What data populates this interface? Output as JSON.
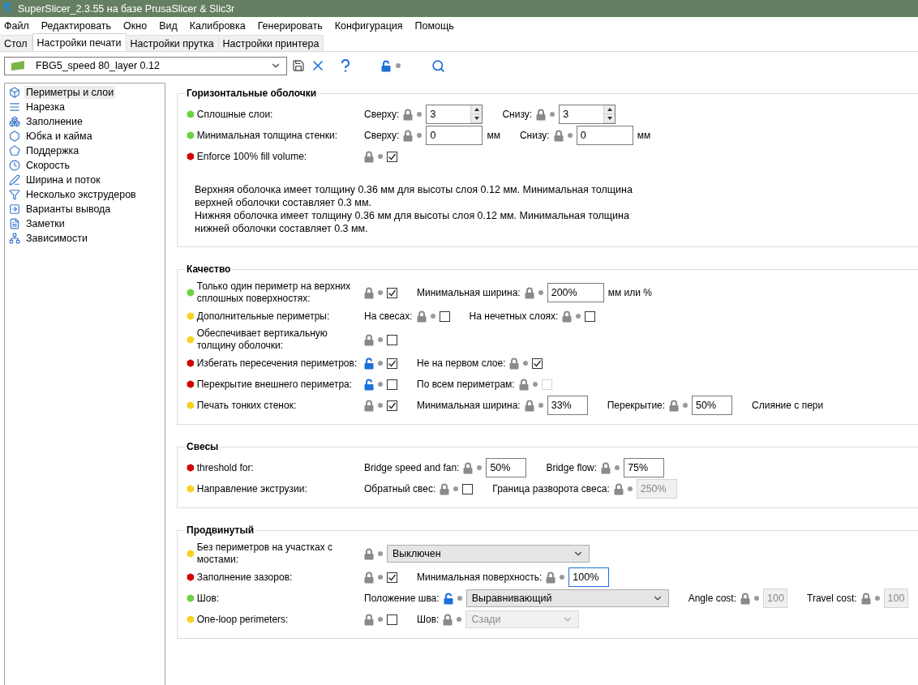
{
  "window": {
    "title": "SuperSlicer_2.3.55 на базе PrusaSlicer & Slic3r"
  },
  "menu": [
    "Файл",
    "Редактировать",
    "Окно",
    "Вид",
    "Калибровка",
    "Генерировать",
    "Конфигурация",
    "Помощь"
  ],
  "tabs": [
    {
      "label": "Стол",
      "selected": false
    },
    {
      "label": "Настройки печати",
      "selected": true
    },
    {
      "label": "Настройки прутка",
      "selected": false
    },
    {
      "label": "Настройки принтера",
      "selected": false
    }
  ],
  "preset": {
    "value": "FBG5_speed 80_layer 0.12",
    "color": "#7ab648"
  },
  "toolbar": {
    "locked": false
  },
  "sidebar": {
    "items": [
      {
        "label": "Периметры и слои",
        "selected": true
      },
      {
        "label": "Нарезка",
        "selected": false
      },
      {
        "label": "Заполнение",
        "selected": false
      },
      {
        "label": "Юбка и кайма",
        "selected": false
      },
      {
        "label": "Поддержка",
        "selected": false
      },
      {
        "label": "Скорость",
        "selected": false
      },
      {
        "label": "Ширина и поток",
        "selected": false
      },
      {
        "label": "Несколько экструдеров",
        "selected": false
      },
      {
        "label": "Варианты вывода",
        "selected": false
      },
      {
        "label": "Заметки",
        "selected": false
      },
      {
        "label": "Зависимости",
        "selected": false
      }
    ]
  },
  "sections": [
    {
      "title": "Горизонтальные оболочки",
      "rows": [
        {
          "label": "Сплошные слои:",
          "color": "#6ad33f",
          "fields": [
            {
              "label": "Сверху:",
              "locked": true,
              "kind": "spin",
              "value": "3"
            },
            {
              "label": "Снизу:",
              "locked": true,
              "kind": "spin",
              "value": "3"
            }
          ]
        },
        {
          "label": "Минимальная толщина стенки:",
          "color": "#6ad33f",
          "fields": [
            {
              "label": "Сверху:",
              "locked": true,
              "kind": "text",
              "value": "0",
              "unit": "мм"
            },
            {
              "label": "Снизу:",
              "locked": true,
              "kind": "text",
              "value": "0",
              "unit": "мм"
            }
          ]
        },
        {
          "label": "Enforce 100% fill volume:",
          "color": "#d40000",
          "fields": [
            {
              "locked": true,
              "kind": "check",
              "checked": true
            }
          ]
        }
      ],
      "notes": [
        "Верхняя оболочка имеет толщину 0.36 мм для высоты слоя 0.12 мм. Минимальная толщина верхней оболочки составляет 0.3 мм.",
        "Нижняя оболочка имеет толщину 0.36 мм для высоты слоя 0.12 мм. Минимальная толщина нижней оболочки составляет 0.3 мм."
      ]
    },
    {
      "title": "Качество",
      "rows": [
        {
          "label": "Только один периметр на верхних сплошных поверхностях:",
          "color": "#6ad33f",
          "fields": [
            {
              "locked": true,
              "kind": "check",
              "checked": true
            },
            {
              "label": "Минимальная ширина:",
              "locked": true,
              "kind": "text",
              "value": "200%",
              "unit": "мм или %"
            }
          ]
        },
        {
          "label": "Дополнительные периметры:",
          "color": "#f7d21e",
          "fields": [
            {
              "label": "На свесах:",
              "locked": true,
              "kind": "check",
              "checked": false
            },
            {
              "label": "На нечетных слоях:",
              "locked": true,
              "kind": "check",
              "checked": false
            }
          ]
        },
        {
          "label": "Обеспечивает вертикальную толщину оболочки:",
          "color": "#f7d21e",
          "fields": [
            {
              "locked": true,
              "kind": "check",
              "checked": false
            }
          ]
        },
        {
          "label": "Избегать пересечения периметров:",
          "color": "#d40000",
          "fields": [
            {
              "locked": false,
              "kind": "check",
              "checked": true
            },
            {
              "label": "Не на первом слое:",
              "locked": true,
              "kind": "check",
              "checked": true
            }
          ]
        },
        {
          "label": "Перекрытие внешнего периметра:",
          "color": "#d40000",
          "fields": [
            {
              "locked": false,
              "kind": "check",
              "checked": false
            },
            {
              "label": "По всем периметрам:",
              "locked": true,
              "kind": "check",
              "checked": false,
              "disabled": true
            }
          ]
        },
        {
          "label": "Печать тонких стенок:",
          "color": "#f7d21e",
          "fields": [
            {
              "locked": true,
              "kind": "check",
              "checked": true
            },
            {
              "label": "Минимальная ширина:",
              "locked": true,
              "kind": "text",
              "value": "33%"
            },
            {
              "label": "Перекрытие:",
              "locked": true,
              "kind": "text",
              "value": "50%"
            },
            {
              "label": "Слияние с пери",
              "kind": "label"
            }
          ]
        }
      ]
    },
    {
      "title": "Свесы",
      "rows": [
        {
          "label": "threshold for:",
          "color": "#d40000",
          "fields": [
            {
              "label": "Bridge speed and fan:",
              "locked": true,
              "kind": "text",
              "value": "50%"
            },
            {
              "label": "Bridge flow:",
              "locked": true,
              "kind": "text",
              "value": "75%"
            }
          ]
        },
        {
          "label": "Направление экструзии:",
          "color": "#f7d21e",
          "fields": [
            {
              "label": "Обратный свес:",
              "locked": true,
              "kind": "check",
              "checked": false
            },
            {
              "label": "Граница разворота свеса:",
              "locked": true,
              "kind": "text",
              "value": "250%",
              "disabled": true
            }
          ]
        }
      ]
    },
    {
      "title": "Продвинутый",
      "rows": [
        {
          "label": "Без периметров на участках с мостами:",
          "color": "#f7d21e",
          "fields": [
            {
              "locked": true,
              "kind": "select",
              "value": "Выключен"
            }
          ]
        },
        {
          "label": "Заполнение зазоров:",
          "color": "#d40000",
          "fields": [
            {
              "locked": true,
              "kind": "check",
              "checked": true
            },
            {
              "label": "Минимальная поверхность:",
              "locked": true,
              "kind": "text",
              "value": "100%",
              "focused": true
            }
          ]
        },
        {
          "label": "Шов:",
          "color": "#6ad33f",
          "fields": [
            {
              "label": "Положение шва:",
              "locked": false,
              "kind": "select",
              "value": "Выравнивающий"
            },
            {
              "label": "Angle cost:",
              "locked": true,
              "kind": "number",
              "value": "100",
              "disabled": true
            },
            {
              "label": "Travel cost:",
              "locked": true,
              "kind": "number",
              "value": "100",
              "disabled": true
            }
          ]
        },
        {
          "label": "One-loop perimeters:",
          "color": "#f7d21e",
          "fields": [
            {
              "locked": true,
              "kind": "check",
              "checked": false
            },
            {
              "label": "Шов:",
              "locked": true,
              "kind": "select",
              "value": "Сзади",
              "disabled": true
            }
          ]
        }
      ]
    }
  ]
}
